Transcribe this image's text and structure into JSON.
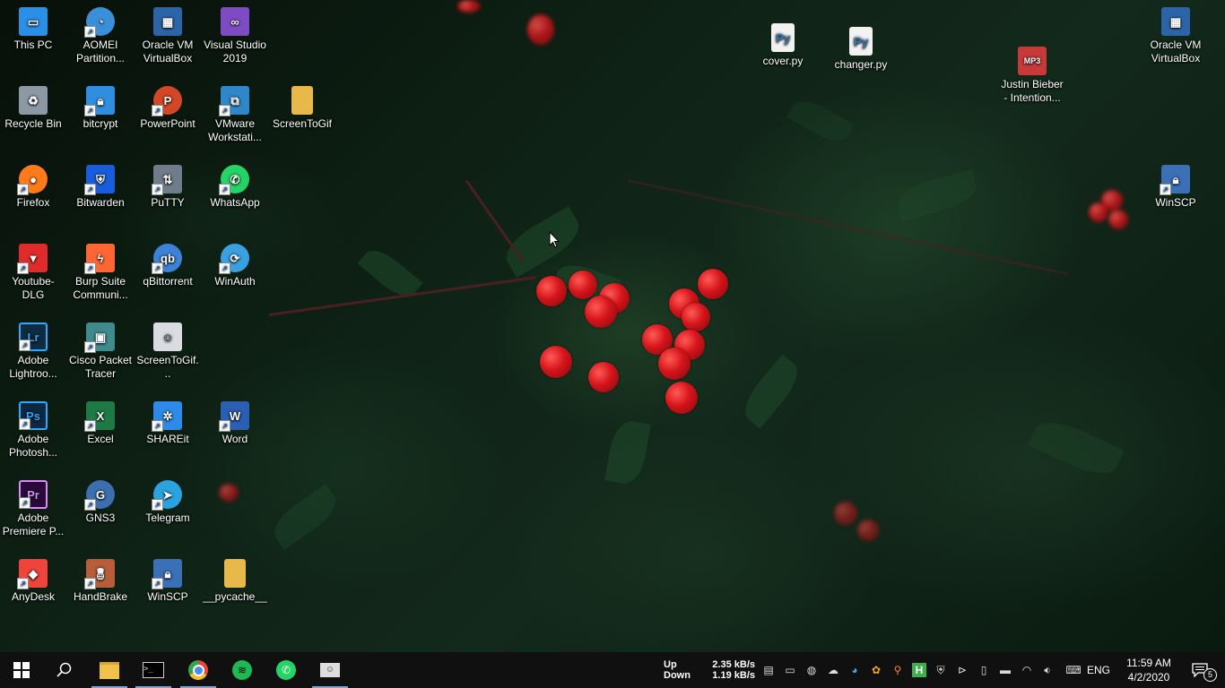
{
  "desktop": {
    "icons": [
      {
        "label": "This PC",
        "icon": "this-pc-icon",
        "color": "#2a8fe6"
      },
      {
        "label": "AOMEI Partition...",
        "icon": "aomei-icon",
        "color": "#3b8fd9"
      },
      {
        "label": "Oracle VM VirtualBox",
        "icon": "virtualbox-icon",
        "color": "#2c64a8"
      },
      {
        "label": "Visual Studio 2019",
        "icon": "visual-studio-icon",
        "color": "#7d4cc3"
      },
      {
        "label": "Recycle Bin",
        "icon": "recycle-bin-icon",
        "color": "#8c98a4"
      },
      {
        "label": "bitcrypt",
        "icon": "bitcrypt-icon",
        "color": "#2f8ee0"
      },
      {
        "label": "PowerPoint",
        "icon": "powerpoint-icon",
        "color": "#d24726"
      },
      {
        "label": "VMware Workstati...",
        "icon": "vmware-icon",
        "color": "#2f87c8"
      },
      {
        "label": "ScreenToGif",
        "icon": "folder-icon",
        "color": "#e8b84a"
      },
      {
        "label": "Firefox",
        "icon": "firefox-icon",
        "color": "#ff7a1a"
      },
      {
        "label": "Bitwarden",
        "icon": "bitwarden-icon",
        "color": "#175ddc"
      },
      {
        "label": "PuTTY",
        "icon": "putty-icon",
        "color": "#6f7c8a"
      },
      {
        "label": "WhatsApp",
        "icon": "whatsapp-icon",
        "color": "#25d366"
      },
      {
        "label": "Youtube-DLG",
        "icon": "youtube-dlg-icon",
        "color": "#e02b2b"
      },
      {
        "label": "Burp Suite Communi...",
        "icon": "burp-suite-icon",
        "color": "#ff6633"
      },
      {
        "label": "qBittorrent",
        "icon": "qbittorrent-icon",
        "color": "#3d82d6"
      },
      {
        "label": "WinAuth",
        "icon": "winauth-icon",
        "color": "#3aa0e0"
      },
      {
        "label": "Adobe Lightroo...",
        "icon": "lightroom-icon",
        "color": "#0f2b3f"
      },
      {
        "label": "Cisco Packet Tracer",
        "icon": "packet-tracer-icon",
        "color": "#3e8a8c"
      },
      {
        "label": "ScreenToGif...",
        "icon": "screentogif-icon",
        "color": "#d9dde2"
      },
      {
        "label": "Adobe Photosh...",
        "icon": "photoshop-icon",
        "color": "#0b2942"
      },
      {
        "label": "Excel",
        "icon": "excel-icon",
        "color": "#1d7a45"
      },
      {
        "label": "SHAREit",
        "icon": "shareit-icon",
        "color": "#2d8ae8"
      },
      {
        "label": "Word",
        "icon": "word-icon",
        "color": "#2b5fb4"
      },
      {
        "label": "Adobe Premiere P...",
        "icon": "premiere-icon",
        "color": "#2a0a3b"
      },
      {
        "label": "GNS3",
        "icon": "gns3-icon",
        "color": "#3c6fb0"
      },
      {
        "label": "Telegram",
        "icon": "telegram-icon",
        "color": "#2aa3e0"
      },
      {
        "label": "AnyDesk",
        "icon": "anydesk-icon",
        "color": "#ef443b"
      },
      {
        "label": "HandBrake",
        "icon": "handbrake-icon",
        "color": "#b85d3a"
      },
      {
        "label": "WinSCP",
        "icon": "winscp-icon",
        "color": "#3b6fb6"
      },
      {
        "label": "__pycache__",
        "icon": "folder-icon",
        "color": "#e8b84a"
      },
      {
        "label": "cover.py",
        "icon": "python-file-icon",
        "color": "#3776ab"
      },
      {
        "label": "changer.py",
        "icon": "python-file-icon",
        "color": "#3776ab"
      },
      {
        "label": "Justin Bieber - Intention...",
        "icon": "mp3-file-icon",
        "color": "#c83a3a"
      },
      {
        "label": "Oracle VM VirtualBox",
        "icon": "virtualbox-icon",
        "color": "#2c64a8"
      },
      {
        "label": "WinSCP",
        "icon": "winscp-icon",
        "color": "#3b6fb6"
      }
    ],
    "mp3_badge": "MP3"
  },
  "taskbar": {
    "pinned": [
      {
        "name": "file-explorer-icon",
        "color": "#f0c24b"
      },
      {
        "name": "terminal-icon",
        "color": "#cccccc"
      },
      {
        "name": "chrome-icon",
        "color": "#e8453c"
      },
      {
        "name": "spotify-icon",
        "color": "#1db954"
      },
      {
        "name": "whatsapp-icon",
        "color": "#25d366"
      },
      {
        "name": "screentogif-icon",
        "color": "#dddddd"
      }
    ],
    "net_up_label": "Up",
    "net_down_label": "Down",
    "net_up_speed": "2.35 kB/s",
    "net_down_speed": "1.19 kB/s",
    "language": "ENG",
    "time": "11:59 AM",
    "date": "4/2/2020",
    "notification_count": "5"
  }
}
